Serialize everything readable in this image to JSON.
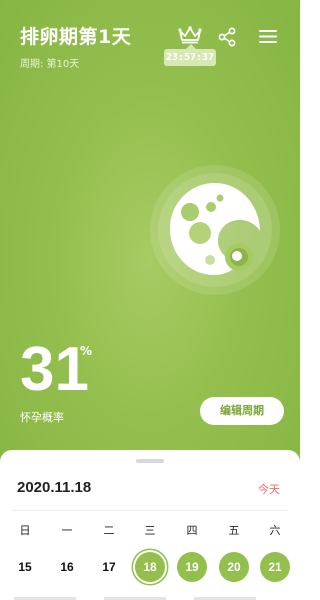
{
  "header": {
    "title": "排卵期第1天",
    "subtitle": "周期: 第10天",
    "timer": "23:57:37",
    "icons": [
      "crown-icon",
      "share-icon",
      "menu-icon"
    ]
  },
  "probability": {
    "value": "31",
    "unit": "%",
    "label": "怀孕概率"
  },
  "edit_button": {
    "label": "编辑周期"
  },
  "calendar": {
    "date": "2020.11.18",
    "today_label": "今天",
    "weekdays": [
      "日",
      "一",
      "二",
      "三",
      "四",
      "五",
      "六"
    ],
    "days": [
      "15",
      "16",
      "17",
      "18",
      "19",
      "20",
      "21"
    ],
    "selected_day": "18"
  },
  "colors": {
    "brand_green": "#93bf4d",
    "today_red": "#f06a6a"
  }
}
